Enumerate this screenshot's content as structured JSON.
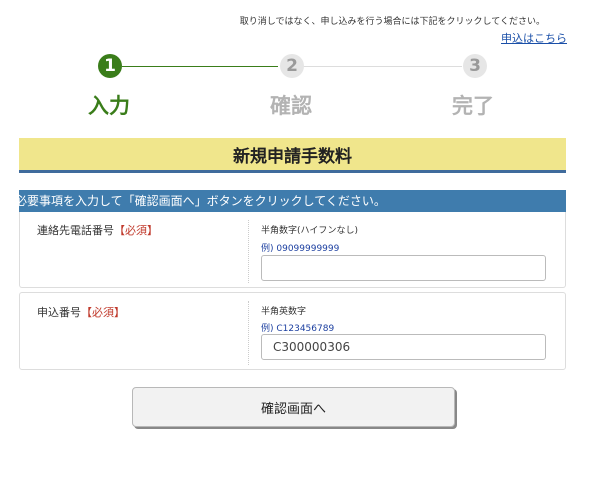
{
  "header": {
    "notice": "取り消しではなく、申し込みを行う場合には下記をクリックしてください。",
    "apply_link": "申込はこちら"
  },
  "steps": [
    {
      "number": "1",
      "label": "入力"
    },
    {
      "number": "2",
      "label": "確認"
    },
    {
      "number": "3",
      "label": "完了"
    }
  ],
  "colors": {
    "accent_green": "#3a7d1a",
    "title_yellow": "#f0e68c",
    "instruction_blue": "#3f7cad",
    "required_red": "#c0392b"
  },
  "page_title": "新規申請手数料",
  "instruction": "必要事項を入力して「確認画面へ」ボタンをクリックしてください。",
  "form": {
    "phone": {
      "label": "連絡先電話番号",
      "required": "【必須】",
      "hint": "半角数字(ハイフンなし)",
      "example": "例) 09099999999",
      "value": ""
    },
    "application": {
      "label": "申込番号",
      "required": "【必須】",
      "hint": "半角英数字",
      "example": "例) C123456789",
      "value": "C300000306"
    }
  },
  "confirm_button": "確認画面へ"
}
